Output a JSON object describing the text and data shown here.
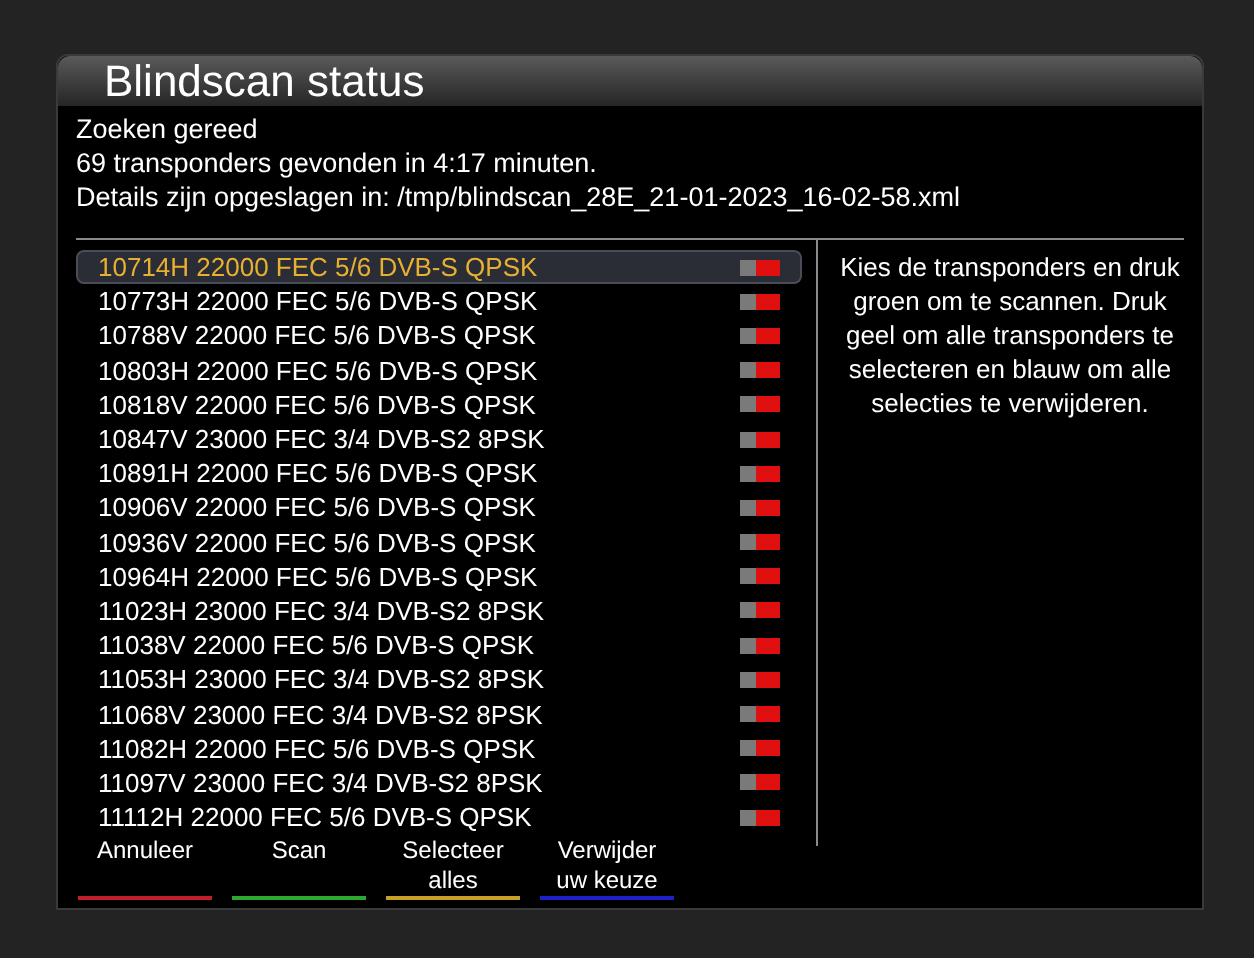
{
  "window": {
    "title": "Blindscan status"
  },
  "status_lines": [
    "Zoeken gereed",
    "69 transponders gevonden in 4:17 minuten.",
    "Details zijn opgeslagen in: /tmp/blindscan_28E_21-01-2023_16-02-58.xml"
  ],
  "transponders": [
    {
      "label": "10714H 22000 FEC 5/6 DVB-S QPSK",
      "selected": true,
      "checked": false
    },
    {
      "label": "10773H 22000 FEC 5/6 DVB-S QPSK",
      "selected": false,
      "checked": false
    },
    {
      "label": "10788V 22000 FEC 5/6 DVB-S QPSK",
      "selected": false,
      "checked": false
    },
    {
      "label": "10803H 22000 FEC 5/6 DVB-S QPSK",
      "selected": false,
      "checked": false
    },
    {
      "label": "10818V 22000 FEC 5/6 DVB-S QPSK",
      "selected": false,
      "checked": false
    },
    {
      "label": "10847V 23000 FEC 3/4 DVB-S2 8PSK",
      "selected": false,
      "checked": false
    },
    {
      "label": "10891H 22000 FEC 5/6 DVB-S QPSK",
      "selected": false,
      "checked": false
    },
    {
      "label": "10906V 22000 FEC 5/6 DVB-S QPSK",
      "selected": false,
      "checked": false
    },
    {
      "label": "10936V 22000 FEC 5/6 DVB-S QPSK",
      "selected": false,
      "checked": false
    },
    {
      "label": "10964H 22000 FEC 5/6 DVB-S QPSK",
      "selected": false,
      "checked": false
    },
    {
      "label": "11023H 23000 FEC 3/4 DVB-S2 8PSK",
      "selected": false,
      "checked": false
    },
    {
      "label": "11038V 22000 FEC 5/6 DVB-S QPSK",
      "selected": false,
      "checked": false
    },
    {
      "label": "11053H 23000 FEC 3/4 DVB-S2 8PSK",
      "selected": false,
      "checked": false
    },
    {
      "label": "11068V 23000 FEC 3/4 DVB-S2 8PSK",
      "selected": false,
      "checked": false
    },
    {
      "label": "11082H 22000 FEC 5/6 DVB-S QPSK",
      "selected": false,
      "checked": false
    },
    {
      "label": "11097V 23000 FEC 3/4 DVB-S2 8PSK",
      "selected": false,
      "checked": false
    },
    {
      "label": "11112H 22000 FEC 5/6 DVB-S QPSK",
      "selected": false,
      "checked": false
    }
  ],
  "help_text": "Kies de transponders en druk groen om te scannen. Druk geel om alle transponders te selecteren en blauw om alle selecties te verwijderen.",
  "buttons": [
    {
      "label": "Annuleer",
      "color": "#c0202a"
    },
    {
      "label": "Scan",
      "color": "#2fa82f"
    },
    {
      "label": "Selecteer alles",
      "color": "#c8a028"
    },
    {
      "label": "Verwijder uw keuze",
      "color": "#2020c8"
    }
  ]
}
